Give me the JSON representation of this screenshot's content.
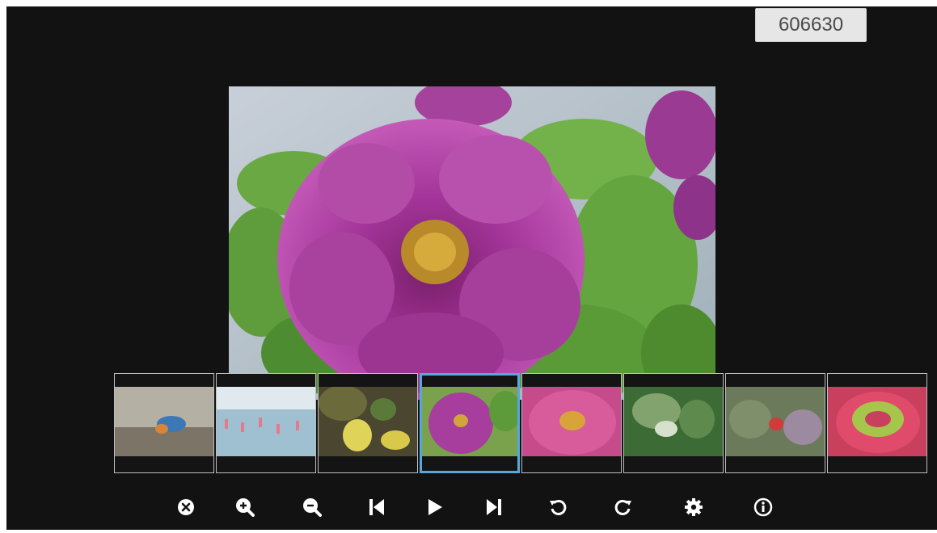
{
  "counter": {
    "value": "606630"
  },
  "viewer": {
    "current_photo": "purple-peony",
    "thumbnails": [
      {
        "subject": "kingfisher-bird",
        "selected": false
      },
      {
        "subject": "flamingos-in-water",
        "selected": false
      },
      {
        "subject": "yellow-flowers",
        "selected": false
      },
      {
        "subject": "purple-peony",
        "selected": true
      },
      {
        "subject": "pink-peony",
        "selected": false
      },
      {
        "subject": "white-flowers",
        "selected": false
      },
      {
        "subject": "red-flowers-foliage",
        "selected": false
      },
      {
        "subject": "flower-wreath",
        "selected": false
      }
    ]
  },
  "toolbar": {
    "buttons": [
      {
        "icon": "close-icon"
      },
      {
        "icon": "zoom-in-icon"
      },
      {
        "icon": "zoom-out-icon"
      },
      {
        "icon": "previous-icon"
      },
      {
        "icon": "play-icon"
      },
      {
        "icon": "next-icon"
      },
      {
        "icon": "rotate-left-icon"
      },
      {
        "icon": "rotate-right-icon"
      },
      {
        "icon": "settings-icon"
      },
      {
        "icon": "info-icon"
      }
    ]
  },
  "colors": {
    "background": "#121212",
    "selection": "#58a8dd",
    "icon": "#ffffff"
  }
}
